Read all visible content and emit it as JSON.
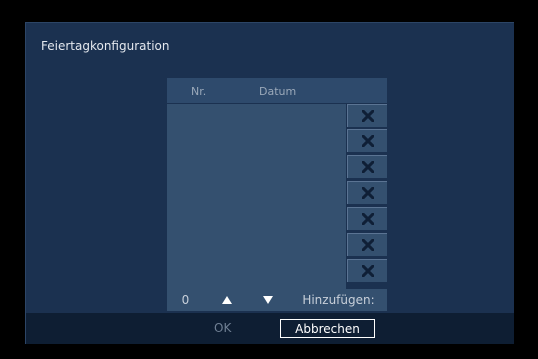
{
  "dialog": {
    "title": "Feiertagkonfiguration"
  },
  "table": {
    "columns": [
      "Nr.",
      "Datum"
    ],
    "rows": [],
    "delete_buttons": 7,
    "delete_icon": "close-x-icon"
  },
  "controls": {
    "count_value": "0",
    "up_icon": "triangle-up-icon",
    "down_icon": "triangle-down-icon",
    "add_label": "Hinzufügen:"
  },
  "footer": {
    "ok_label": "OK",
    "cancel_label": "Abbrechen"
  },
  "colors": {
    "dialog_bg": "#1b3150",
    "cell_bg": "#34506f",
    "footer_bg": "#0e1e33",
    "text": "#e4e8ee",
    "disabled_text": "#6f7f93"
  }
}
